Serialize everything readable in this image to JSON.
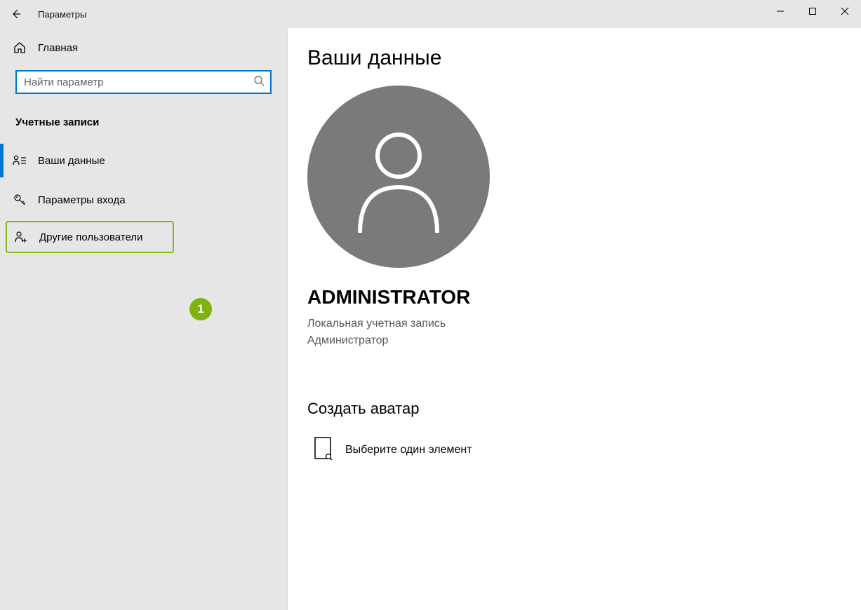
{
  "window": {
    "title": "Параметры"
  },
  "sidebar": {
    "home_label": "Главная",
    "search_placeholder": "Найти параметр",
    "section_header": "Учетные записи",
    "items": [
      {
        "label": "Ваши данные"
      },
      {
        "label": "Параметры входа"
      },
      {
        "label": "Другие пользователи"
      }
    ],
    "annotation_badge_text": "1"
  },
  "main": {
    "page_title": "Ваши данные",
    "user_name": "ADMINISTRATOR",
    "user_account_type": "Локальная учетная запись",
    "user_role": "Администратор",
    "create_avatar_title": "Создать аватар",
    "browse_label": "Выберите один элемент"
  }
}
